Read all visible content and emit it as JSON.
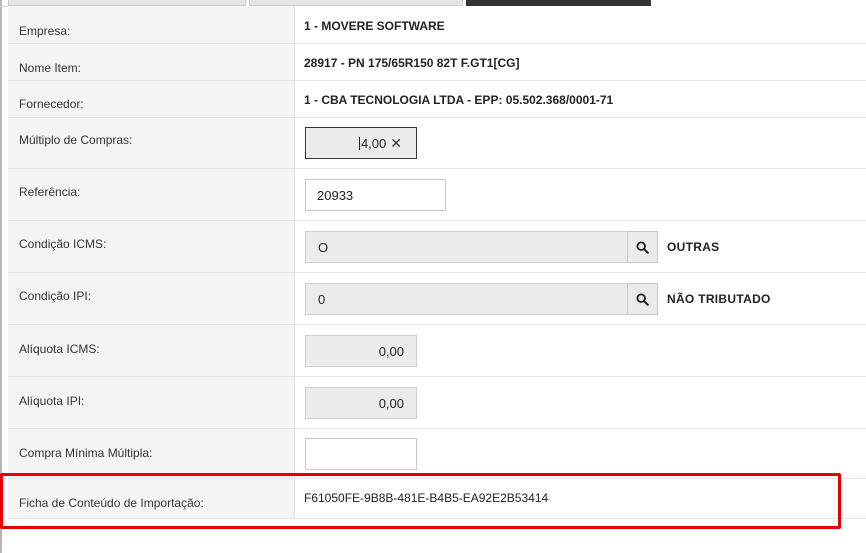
{
  "form": {
    "empresa": {
      "label": "Empresa:",
      "value": "1 - MOVERE SOFTWARE"
    },
    "nome_item": {
      "label": "Nome Item:",
      "value": "28917 - PN 175/65R150 82T F.GT1[CG]"
    },
    "fornecedor": {
      "label": "Fornecedor:",
      "value": "1 - CBA TECNOLOGIA LTDA - EPP: 05.502.368/0001-71"
    },
    "multiplo_compras": {
      "label": "Múltiplo de Compras:",
      "value": "4,00",
      "clear_glyph": "✕"
    },
    "referencia": {
      "label": "Referência:",
      "value": "20933"
    },
    "condicao_icms": {
      "label": "Condição ICMS:",
      "value": "O",
      "description": "OUTRAS"
    },
    "condicao_ipi": {
      "label": "Condição IPI:",
      "value": "0",
      "description": "NÃO TRIBUTADO"
    },
    "aliquota_icms": {
      "label": "Alíquota ICMS:",
      "value": "0,00"
    },
    "aliquota_ipi": {
      "label": "Alíquota IPI:",
      "value": "0,00"
    },
    "compra_minima_multipla": {
      "label": "Compra Mínima Múltipla:",
      "value": ""
    },
    "ficha_conteudo_importacao": {
      "label": "Ficha de Conteúdo de Importação:",
      "value": "F61050FE-9B8B-481E-B4B5-EA92E2B53414"
    }
  },
  "icons": {
    "lookup": "search-icon",
    "clear": "close-icon"
  },
  "colors": {
    "highlight_border": "#e60000",
    "active_tab": "#333333"
  }
}
